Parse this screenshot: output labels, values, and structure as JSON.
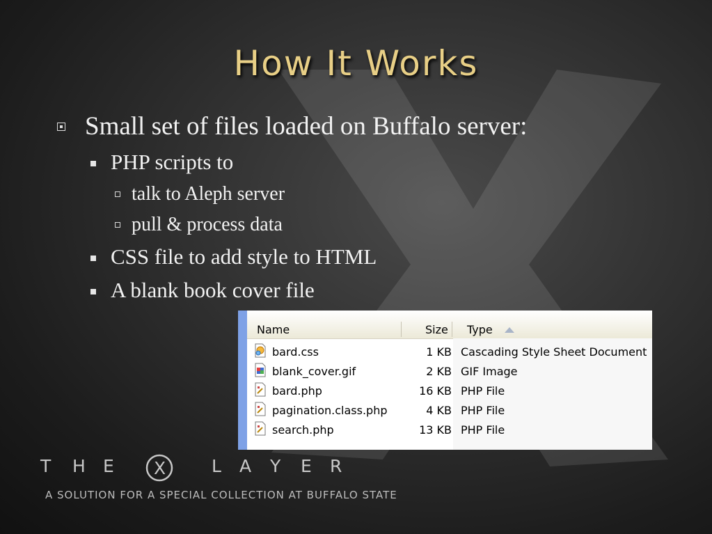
{
  "slide": {
    "title": "How It Works",
    "bullets": [
      {
        "text": "Small set of files loaded on Buffalo server:"
      },
      {
        "text": "PHP scripts to"
      },
      {
        "text": "talk to Aleph server"
      },
      {
        "text": "pull & process data"
      },
      {
        "text": "CSS file to add style to HTML"
      },
      {
        "text": "A blank book cover file"
      }
    ]
  },
  "explorer": {
    "columns": {
      "name": "Name",
      "size": "Size",
      "type": "Type"
    },
    "sort_icon": "sort-ascending-icon",
    "files": [
      {
        "name": "bard.css",
        "size": "1 KB",
        "type": "Cascading Style Sheet Document",
        "icon": "css-file-icon"
      },
      {
        "name": "blank_cover.gif",
        "size": "2 KB",
        "type": "GIF Image",
        "icon": "gif-file-icon"
      },
      {
        "name": "bard.php",
        "size": "16 KB",
        "type": "PHP File",
        "icon": "php-file-icon"
      },
      {
        "name": "pagination.class.php",
        "size": "4 KB",
        "type": "PHP File",
        "icon": "php-file-icon"
      },
      {
        "name": "search.php",
        "size": "13 KB",
        "type": "PHP File",
        "icon": "php-file-icon"
      }
    ],
    "colors": {
      "sidebar": "#7ea1e6",
      "header": "#ece9d8"
    }
  },
  "footer": {
    "logo_letters": [
      "T",
      "H",
      "E",
      "X",
      "L",
      "A",
      "Y",
      "E",
      "R"
    ],
    "tagline": "A SOLUTION FOR A SPECIAL COLLECTION AT BUFFALO STATE"
  },
  "colors": {
    "title": "#e8cf86",
    "text": "#f2f2f2",
    "background": "#2a2a2a"
  }
}
